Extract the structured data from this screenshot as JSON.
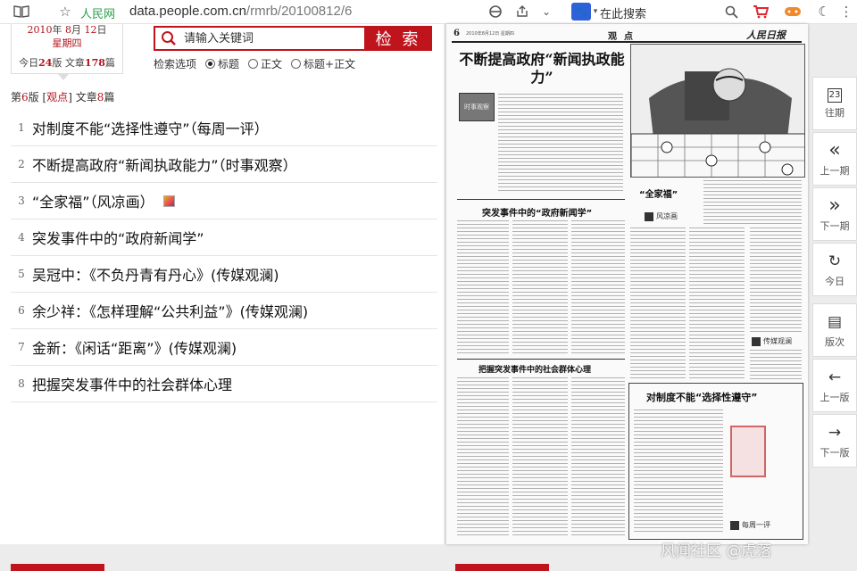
{
  "browser": {
    "site_name": "人民网",
    "url_domain": "data.people.com.cn",
    "url_path": "/rmrb/20100812/6",
    "search_label": "在此搜索"
  },
  "datebox": {
    "year": "2010",
    "month": "8",
    "day": "12",
    "weekday": "星期四",
    "today_prefix": "今日",
    "pages": "24",
    "pages_unit": "版",
    "articles_prefix": "文章",
    "articles": "178",
    "articles_unit": "篇",
    "year_unit": "年",
    "month_unit": "月",
    "day_unit": "日"
  },
  "search": {
    "placeholder": "请输入关键词",
    "button": "检 索",
    "options_label": "检索选项",
    "options": [
      "标题",
      "正文",
      "标题+正文"
    ],
    "selected": 0
  },
  "section": {
    "prefix": "第",
    "page": "6",
    "page_unit": "版",
    "name": "观点",
    "count_prefix": "文章",
    "count": "8",
    "count_unit": "篇"
  },
  "articles": [
    {
      "num": "1",
      "title": "对制度不能“选择性遵守”（每周一评）"
    },
    {
      "num": "2",
      "title": "不断提高政府“新闻执政能力”（时事观察）"
    },
    {
      "num": "3",
      "title": "“全家福”（风凉画）"
    },
    {
      "num": "4",
      "title": "突发事件中的“政府新闻学”"
    },
    {
      "num": "5",
      "title": "吴冠中：《不负丹青有丹心》(传媒观澜)"
    },
    {
      "num": "6",
      "title": "余少祥：《怎样理解“公共利益”》(传媒观澜)"
    },
    {
      "num": "7",
      "title": "金新：《闲话“距离”》(传媒观澜)"
    },
    {
      "num": "8",
      "title": "把握突发事件中的社会群体心理"
    }
  ],
  "newspaper": {
    "page_num": "6",
    "date": "2010年8月12日 星期四",
    "section": "观点",
    "logo": "人民日报",
    "headline_main": "不断提高政府“新闻执政能力”",
    "headline_news": "突发事件中的“政府新闻学”",
    "headline_psych": "把握突发事件中的社会群体心理",
    "headline_cartoon": "“全家福”",
    "label_fengliang": "风凉画",
    "label_media": "传媒观澜",
    "headline_system": "对制度不能“选择性遵守”",
    "label_weekly": "每周一评",
    "small_pic_text": "时事观察"
  },
  "rightnav": [
    {
      "icon": "calendar-icon",
      "glyph": "23",
      "label": "往期"
    },
    {
      "icon": "double-left-icon",
      "glyph": "«",
      "label": "上一期"
    },
    {
      "icon": "double-right-icon",
      "glyph": "»",
      "label": "下一期"
    },
    {
      "icon": "refresh-icon",
      "glyph": "↻",
      "label": "今日"
    },
    {
      "icon": "pages-icon",
      "glyph": "▤",
      "label": "版次"
    },
    {
      "icon": "arrow-left-icon",
      "glyph": "←",
      "label": "上一版"
    },
    {
      "icon": "arrow-right-icon",
      "glyph": "→",
      "label": "下一版"
    }
  ],
  "watermark": "风闻社区 @虎落",
  "colors": {
    "brand_red": "#c0141d",
    "site_green": "#2a9d4a"
  }
}
